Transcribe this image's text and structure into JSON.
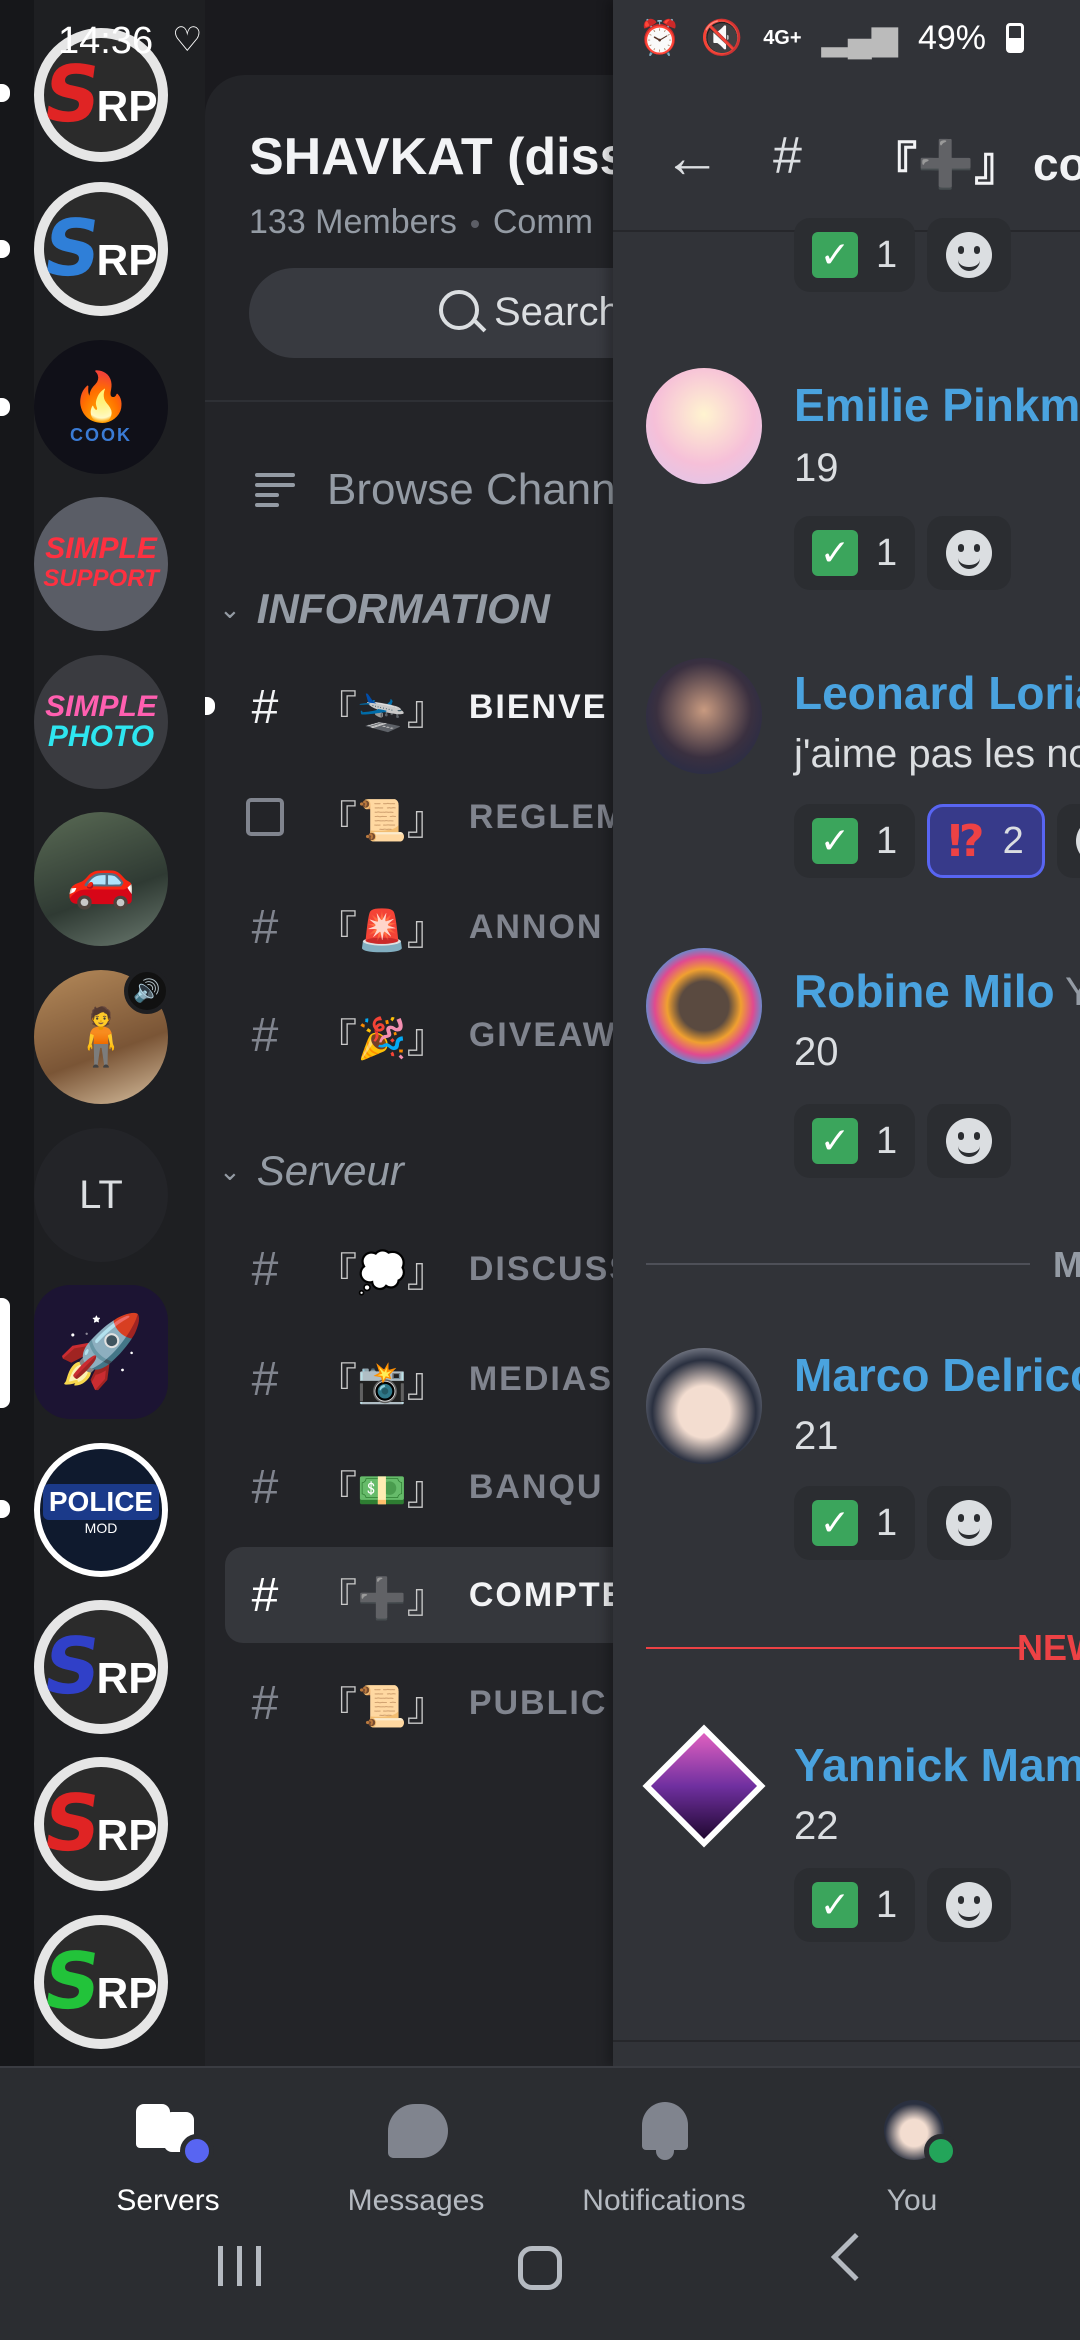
{
  "status_bar": {
    "time": "14:36",
    "network": "4G+",
    "battery": "49%"
  },
  "servers": {
    "lt_label": "LT",
    "srp_letters": "S",
    "srp_sub": "RP",
    "simple_support": [
      "SIMPLE",
      "SUPPORT"
    ],
    "simple_photo": [
      "SIMPLE",
      "PHOTO"
    ],
    "cook_label": "COOK",
    "police_label": "POLICE",
    "police_sub": "MOD"
  },
  "guild": {
    "title": "SHAVKAT (diss",
    "members": "133 Members",
    "community": "Comm",
    "search_label": "Search",
    "browse_label": "Browse Chann"
  },
  "categories": {
    "information": "INFORMATION",
    "serveur": "Serveur"
  },
  "channels": [
    {
      "emoji": "『🛬』",
      "name": "BIENVE"
    },
    {
      "emoji": "『📜』",
      "name": "REGLEM"
    },
    {
      "emoji": "『🚨』",
      "name": "ANNON"
    },
    {
      "emoji": "『🎉』",
      "name": "GIVEAW"
    },
    {
      "emoji": "『💭』",
      "name": "DISCUSS"
    },
    {
      "emoji": "『📸』",
      "name": "MEDIAS"
    },
    {
      "emoji": "『💵』",
      "name": "BANQU"
    },
    {
      "emoji": "『➕』",
      "name": "COMPTE"
    },
    {
      "emoji": "『📜』",
      "name": "PUBLIC"
    }
  ],
  "chat": {
    "back_icon": "arrow-left-icon",
    "header_hash": "#",
    "header_title": "『➕』 co",
    "top_reaction_count": "1",
    "messages": [
      {
        "author": "Emilie Pinkma",
        "text": "19",
        "check_count": "1"
      },
      {
        "author": "Leonard Loria",
        "text": "j'aime pas les no",
        "check_count": "1",
        "extra_count": "2",
        "extra_emoji": "⁉"
      },
      {
        "author": "Robine Milo",
        "text": "20",
        "check_count": "1",
        "badge": "Y"
      },
      {
        "author": "Marco Delrico",
        "text": "21",
        "check_count": "1"
      },
      {
        "author": "Yannick Mama",
        "text": "22",
        "check_count": "1"
      }
    ],
    "separator_date": "M",
    "new_label": "NEW"
  },
  "bottom_nav": {
    "servers": "Servers",
    "messages": "Messages",
    "notifications": "Notifications",
    "you": "You"
  },
  "colors": {
    "username": "#4aa3df",
    "check": "#3ba55c",
    "new": "#ed4245",
    "blurple": "#5865f2"
  }
}
